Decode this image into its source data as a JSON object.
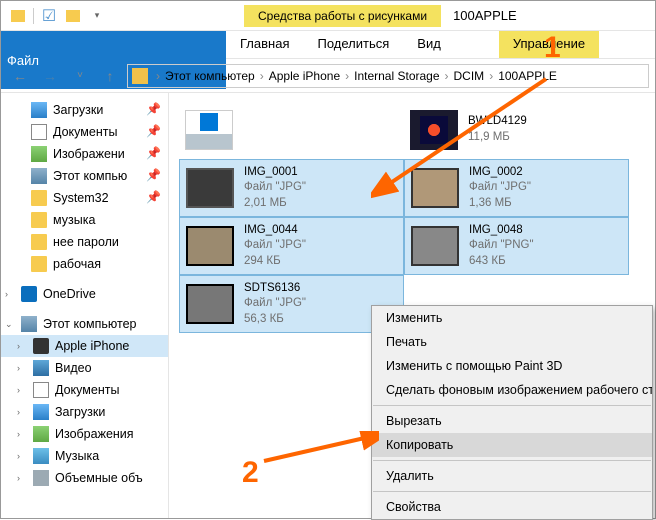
{
  "window": {
    "context_tab": "Средства работы с рисунками",
    "folder_name": "100APPLE"
  },
  "ribbon": {
    "file": "Файл",
    "home": "Главная",
    "share": "Поделиться",
    "view": "Вид",
    "manage": "Управление"
  },
  "breadcrumbs": [
    "Этот компьютер",
    "Apple iPhone",
    "Internal Storage",
    "DCIM",
    "100APPLE"
  ],
  "sidebar": {
    "downloads": "Загрузки",
    "documents": "Документы",
    "pictures": "Изображени",
    "thispc_quick": "Этот компью",
    "system32": "System32",
    "music_q": "музыка",
    "nopass": "нее пароли",
    "work": "рабочая",
    "onedrive": "OneDrive",
    "thispc": "Этот компьютер",
    "iphone": "Apple iPhone",
    "video": "Видео",
    "documents2": "Документы",
    "downloads2": "Загрузки",
    "pictures2": "Изображения",
    "music2": "Музыка",
    "volumes": "Объемные объ"
  },
  "files": [
    {
      "name": "",
      "meta1": "",
      "meta2": "",
      "thumb": "drive",
      "sel": false
    },
    {
      "name": "BWLD4129",
      "meta1": "11,9 МБ",
      "meta2": "",
      "thumb": "vid",
      "sel": false
    },
    {
      "name": "IMG_0001",
      "meta1": "Файл \"JPG\"",
      "meta2": "2,01 МБ",
      "thumb": "dark",
      "sel": true
    },
    {
      "name": "IMG_0002",
      "meta1": "Файл \"JPG\"",
      "meta2": "1,36 МБ",
      "thumb": "tan",
      "sel": true
    },
    {
      "name": "IMG_0044",
      "meta1": "Файл \"JPG\"",
      "meta2": "294 КБ",
      "thumb": "brn",
      "sel": true
    },
    {
      "name": "IMG_0048",
      "meta1": "Файл \"PNG\"",
      "meta2": "643 КБ",
      "thumb": "gr1",
      "sel": true
    },
    {
      "name": "SDTS6136",
      "meta1": "Файл \"JPG\"",
      "meta2": "56,3 КБ",
      "thumb": "gr2",
      "sel": true
    }
  ],
  "context_menu": {
    "edit": "Изменить",
    "print": "Печать",
    "paint3d": "Изменить с помощью Paint 3D",
    "wallpaper": "Сделать фоновым изображением рабочего стола",
    "cut": "Вырезать",
    "copy": "Копировать",
    "delete": "Удалить",
    "properties": "Свойства"
  },
  "annotations": {
    "one": "1",
    "two": "2"
  }
}
